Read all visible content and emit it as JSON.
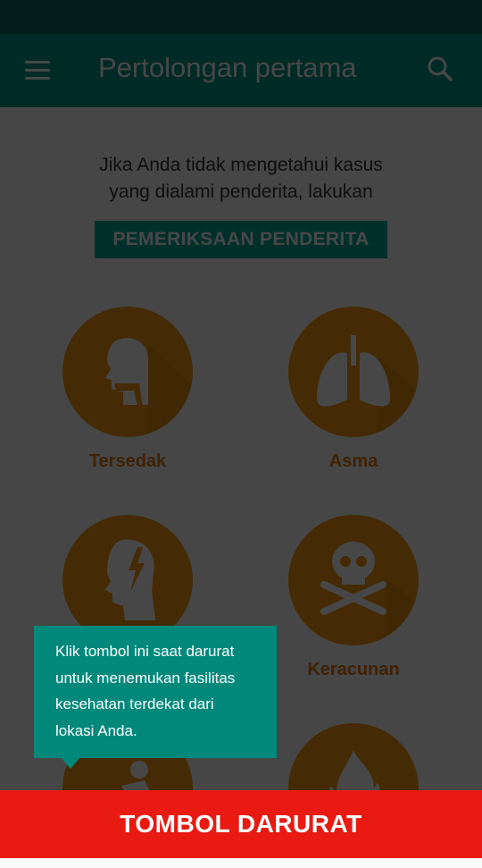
{
  "app_bar": {
    "title": "Pertolongan pertama",
    "menu_icon": "hamburger-menu-icon",
    "search_icon": "search-icon",
    "color": "#009688"
  },
  "intro": {
    "line1": "Jika Anda tidak mengetahui kasus",
    "line2": "yang dialami penderita, lakukan"
  },
  "exam_button": {
    "label": "PEMERIKSAAN PENDERITA",
    "color": "#00a897"
  },
  "items": [
    {
      "label": "Tersedak",
      "icon": "choking-throat-icon"
    },
    {
      "label": "Asma",
      "icon": "lungs-icon"
    },
    {
      "label": "",
      "icon": "head-pain-icon"
    },
    {
      "label": "Keracunan",
      "icon": "skull-crossbones-icon"
    },
    {
      "label": "",
      "icon": "injury-icon"
    },
    {
      "label": "",
      "icon": "fire-burn-icon"
    }
  ],
  "tooltip": {
    "lines": [
      "Klik tombol ini saat darurat",
      "untuk menemukan fasilitas",
      "kesehatan terdekat dari",
      "lokasi Anda."
    ],
    "color": "#00897b"
  },
  "emergency_button": {
    "label": "TOMBOL DARURAT",
    "color": "#e81a12"
  },
  "accent_orange": "#f39c12"
}
